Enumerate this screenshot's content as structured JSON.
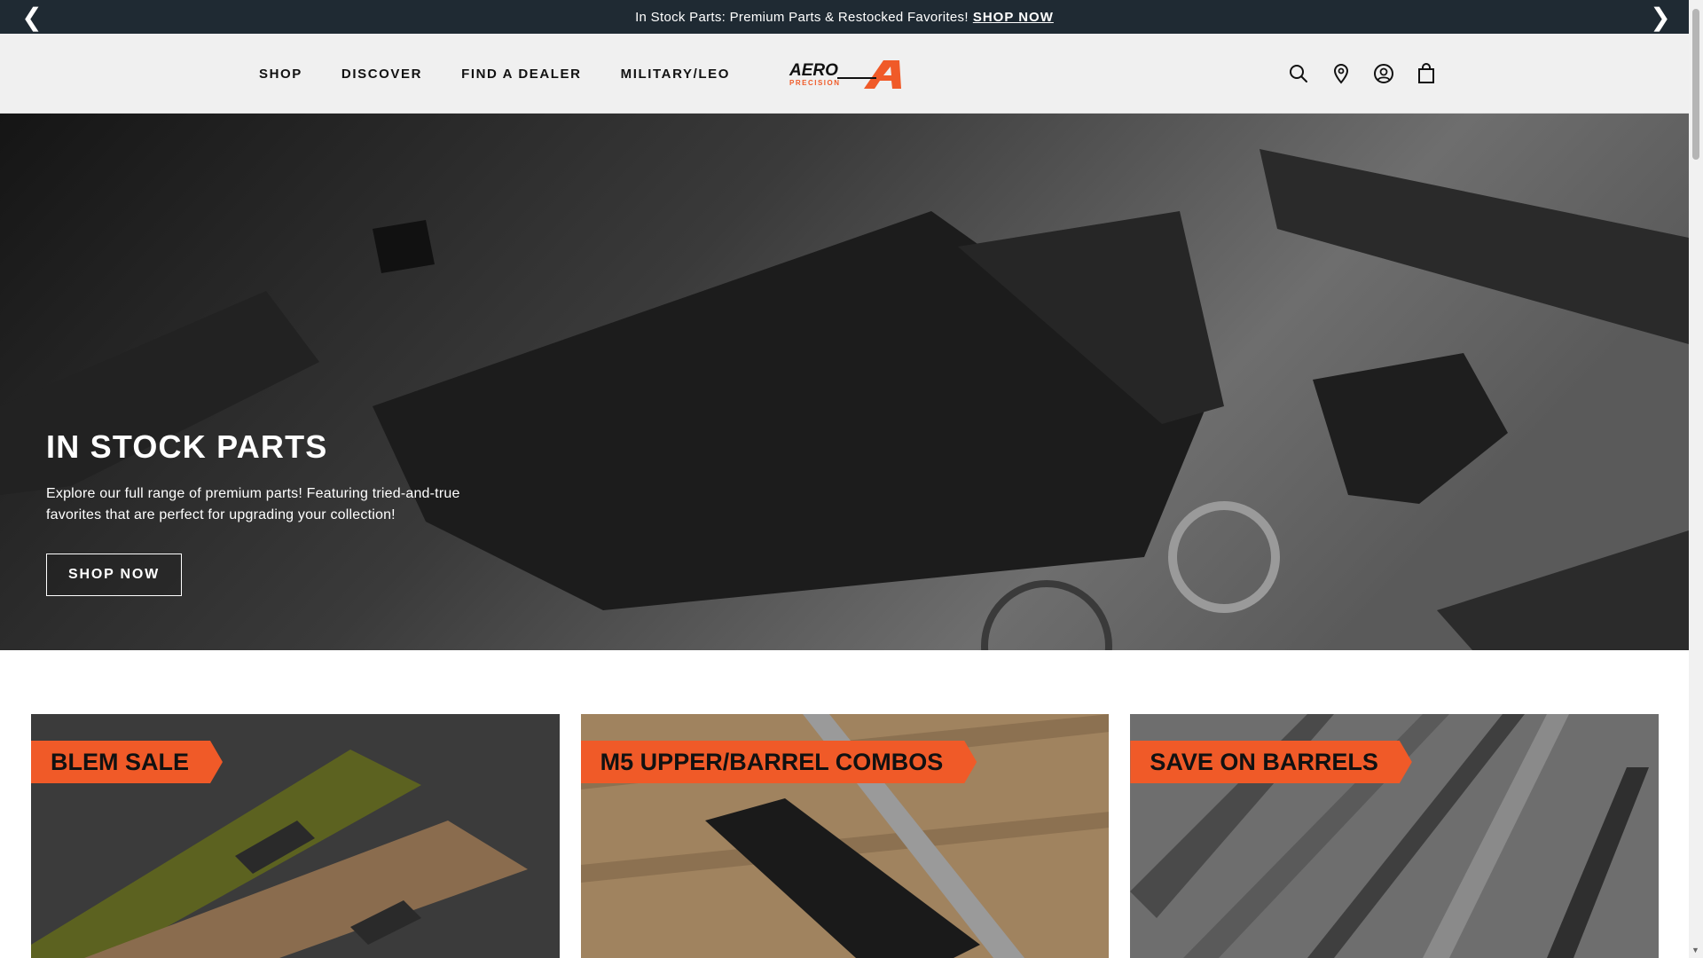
{
  "announcement": {
    "text": "In Stock Parts: Premium Parts & Restocked Favorites!",
    "link": "SHOP NOW",
    "prev_icon": "chevron-left-icon",
    "next_icon": "chevron-right-icon"
  },
  "nav": {
    "items": [
      "SHOP",
      "DISCOVER",
      "FIND A DEALER",
      "MILITARY/LEO"
    ]
  },
  "logo": {
    "top": "AERO",
    "bottom": "PRECISION"
  },
  "header_icons": [
    "search-icon",
    "location-pin-icon",
    "account-icon",
    "shopping-bag-icon"
  ],
  "hero": {
    "title": "IN STOCK PARTS",
    "description": "Explore our full range of premium parts! Featuring tried-and-true favorites that are perfect for upgrading your collection!",
    "button": "SHOP NOW"
  },
  "cards": [
    {
      "label": "BLEM SALE"
    },
    {
      "label": "M5 UPPER/BARREL COMBOS"
    },
    {
      "label": "SAVE ON BARRELS"
    }
  ],
  "colors": {
    "announcement_bg": "#1f2a33",
    "accent": "#f05a28",
    "header_bg": "#f0f0f0"
  }
}
